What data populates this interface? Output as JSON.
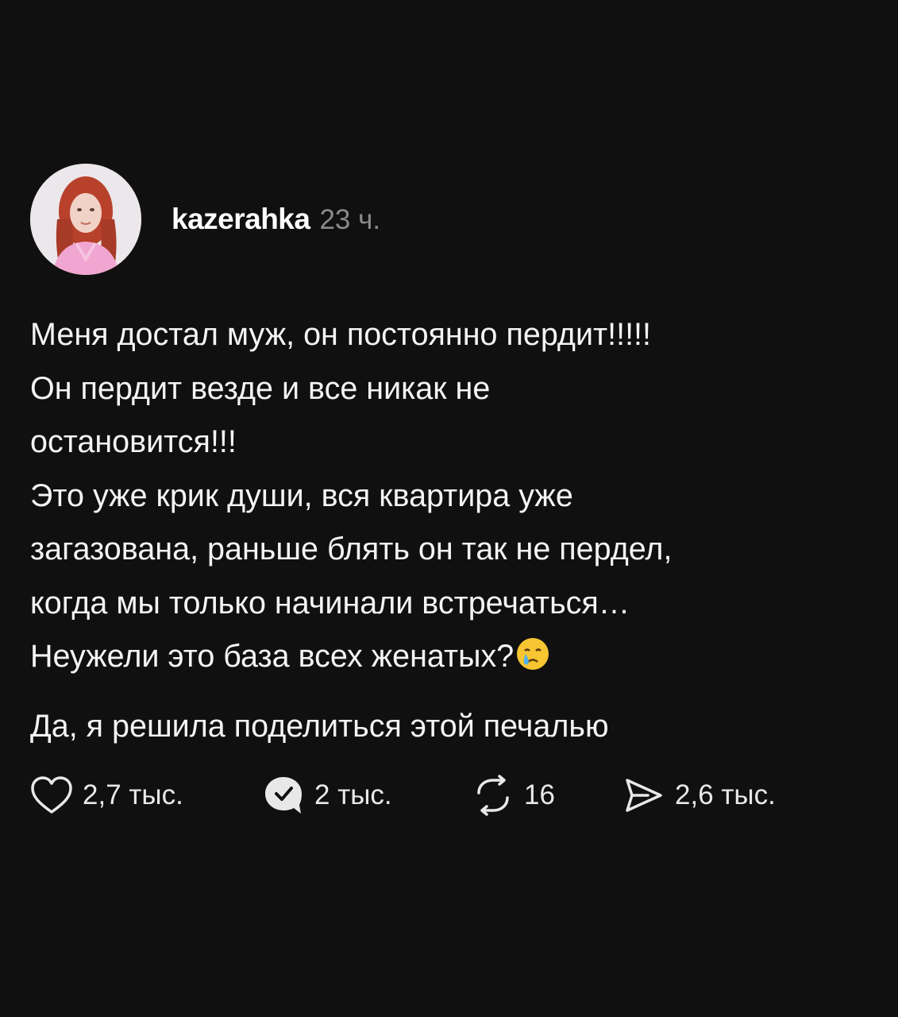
{
  "post": {
    "author": {
      "username": "kazerahka",
      "time": "23 ч.",
      "avatar": "avatar-photo"
    },
    "paragraph1": "Меня достал муж, он постоянно пердит!!!!!\nОн пердит везде и все никак не\nостановится!!!\nЭто уже крик души, вся квартира уже\nзагазована, раньше блять он так не пердел,\nкогда мы только начинали встречаться…\nНеужели это база всех женатых?",
    "paragraph1_emoji": "crying-face-emoji",
    "paragraph2": "Да, я решила поделиться этой печалью"
  },
  "actions": {
    "likes": {
      "icon": "heart-icon",
      "count": "2,7 тыс."
    },
    "comments": {
      "icon": "comment-check-icon",
      "count": "2 тыс."
    },
    "reposts": {
      "icon": "repost-icon",
      "count": "16"
    },
    "shares": {
      "icon": "send-icon",
      "count": "2,6 тыс."
    }
  },
  "colors": {
    "background": "#101010",
    "text": "#f4f4f4",
    "muted": "#8a8a8a"
  }
}
